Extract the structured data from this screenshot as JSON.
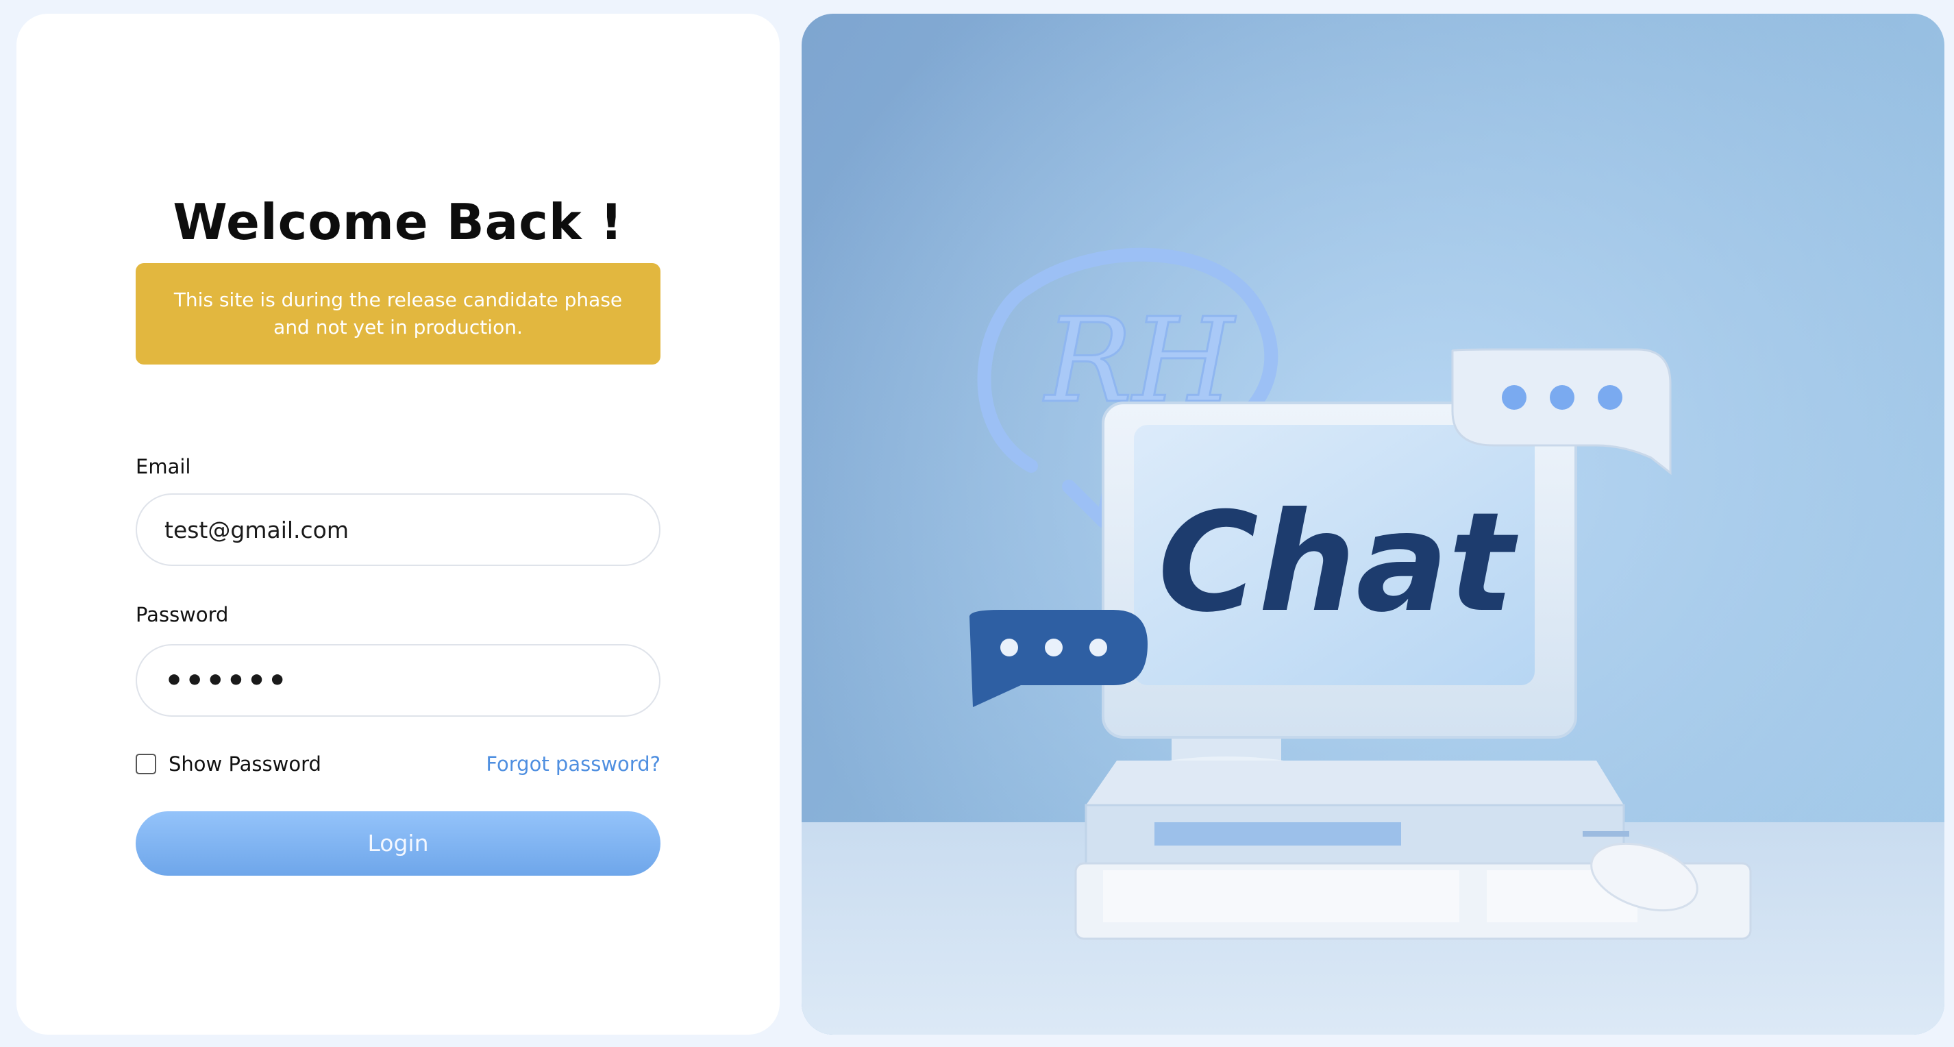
{
  "login": {
    "title": "Welcome Back !",
    "notice": "This site is during the release candidate phase and not yet in production.",
    "email_label": "Email",
    "email_value": "test@gmail.com",
    "password_label": "Password",
    "password_value": "••••••",
    "show_password_label": "Show Password",
    "show_password_checked": false,
    "forgot_label": "Forgot password?",
    "login_button": "Login"
  },
  "hero": {
    "logo_text": "RH",
    "screen_text": "Chat"
  },
  "colors": {
    "notice_bg": "#e2b73f",
    "accent": "#4f8fe0",
    "button": "#7fb3f1",
    "page_bg": "#eef4fd"
  }
}
